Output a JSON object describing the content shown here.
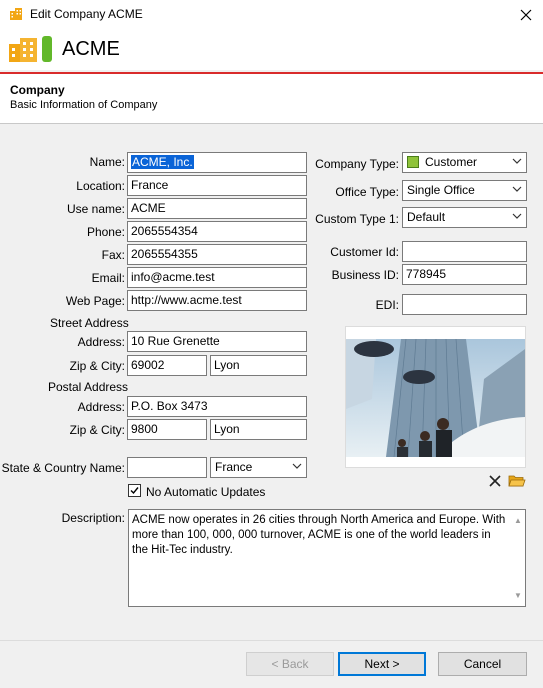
{
  "window": {
    "title": "Edit Company ACME"
  },
  "header": {
    "company_name": "ACME"
  },
  "section": {
    "title": "Company",
    "subtitle": "Basic Information of Company"
  },
  "form": {
    "name_label": "Name:",
    "name_value": "ACME, Inc.",
    "location_label": "Location:",
    "location_value": "France",
    "usename_label": "Use name:",
    "usename_value": "ACME",
    "phone_label": "Phone:",
    "phone_value": "2065554354",
    "fax_label": "Fax:",
    "fax_value": "2065554355",
    "email_label": "Email:",
    "email_value": "info@acme.test",
    "webpage_label": "Web Page:",
    "webpage_value": "http://www.acme.test",
    "street_heading": "Street Address",
    "street_address_label": "Address:",
    "street_address_value": "10 Rue Grenette",
    "street_zip_label": "Zip & City:",
    "street_zip_value": "69002",
    "street_city_value": "Lyon",
    "postal_heading": "Postal Address",
    "postal_address_label": "Address:",
    "postal_address_value": "P.O. Box 3473",
    "postal_zip_label": "Zip & City:",
    "postal_zip_value": "9800",
    "postal_city_value": "Lyon",
    "state_country_label": "State & Country Name:",
    "state_value": "",
    "country_value": "France",
    "no_updates_label": "No Automatic Updates",
    "no_updates_checked": true,
    "description_label": "Description:",
    "description_value": "ACME now operates in 26 cities through North America and Europe. With more than 100, 000, 000 turnover, ACME is one of the world leaders in the Hit-Tec industry.",
    "company_type_label": "Company Type:",
    "company_type_value": "Customer",
    "company_type_color": "#8fc33a",
    "office_type_label": "Office Type:",
    "office_type_value": "Single Office",
    "custom_type_label": "Custom Type 1:",
    "custom_type_value": "Default",
    "customer_id_label": "Customer Id:",
    "customer_id_value": "",
    "business_id_label": "Business ID:",
    "business_id_value": "778945",
    "edi_label": "EDI:",
    "edi_value": ""
  },
  "footer": {
    "back_label": "< Back",
    "next_label": "Next >",
    "cancel_label": "Cancel"
  },
  "colors": {
    "accent_line": "#d92b2b",
    "logo_green": "#62b82a",
    "icon_orange": "#f2a614",
    "focus_blue": "#0078d7"
  }
}
